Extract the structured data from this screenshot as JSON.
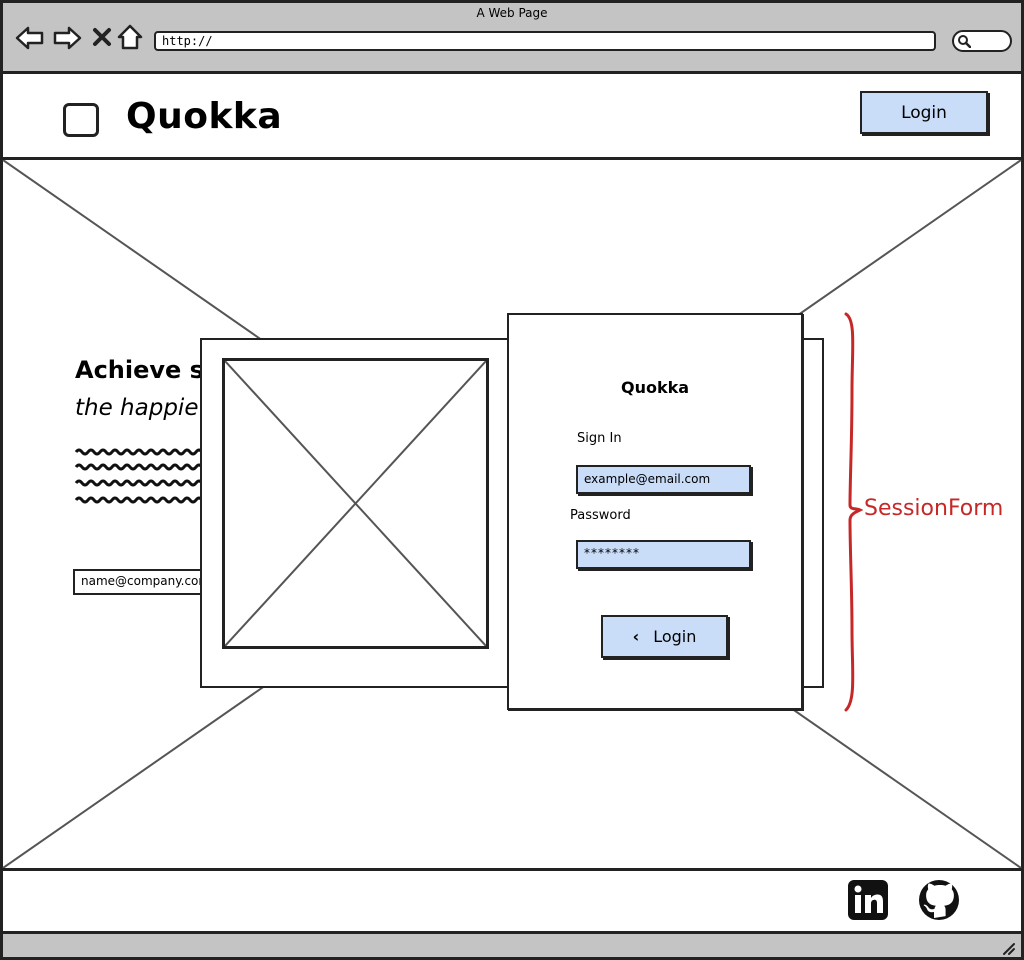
{
  "browser": {
    "window_title": "A Web Page",
    "url": "http://",
    "nav_icons": [
      "back-arrow-icon",
      "forward-arrow-icon",
      "close-icon",
      "home-icon"
    ],
    "search_icon": "search-icon"
  },
  "header": {
    "brand": "Quokka",
    "login_label": "Login"
  },
  "hero": {
    "heading": "Achieve s",
    "subheading": "the happie",
    "email_placeholder": "name@company.com"
  },
  "session_form": {
    "title": "Quokka",
    "sign_in_label": "Sign In",
    "email_value": "example@email.com",
    "password_label": "Password",
    "password_value": "********",
    "login_label": "Login",
    "login_icon": "chevron-left-icon"
  },
  "annotation": {
    "label": "SessionForm",
    "color": "#c62828"
  },
  "footer": {
    "icons": [
      "linkedin-icon",
      "github-icon"
    ]
  },
  "colors": {
    "chrome": "#c4c4c4",
    "button_fill": "#c9dcf8",
    "stroke": "#222222"
  }
}
